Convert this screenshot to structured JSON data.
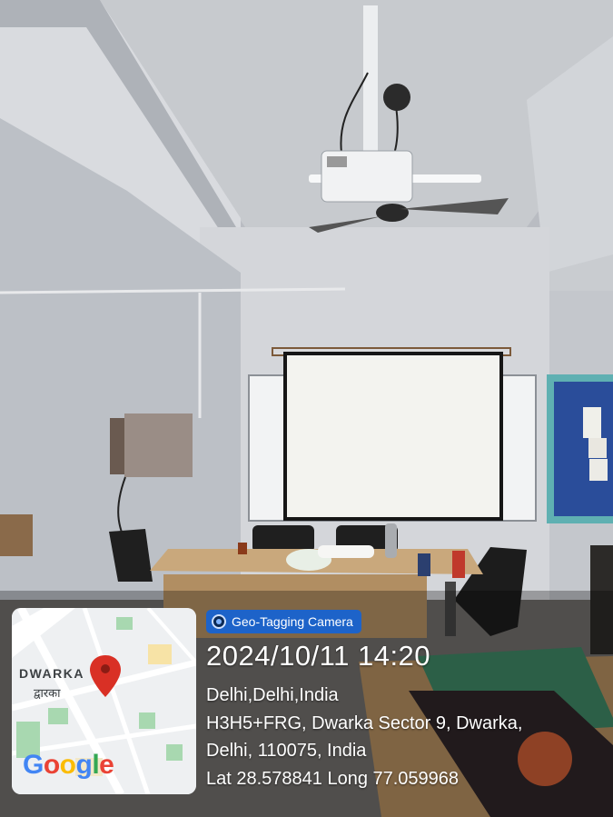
{
  "badge": {
    "label": "Geo-Tagging Camera",
    "icon": "camera-icon"
  },
  "datetime": "2024/10/11 14:20",
  "address": {
    "line1": "Delhi,Delhi,India",
    "line2": "H3H5+FRG, Dwarka Sector 9, Dwarka,",
    "line3": "Delhi, 110075, India"
  },
  "coordinates": "Lat 28.578841 Long 77.059968",
  "map": {
    "label_en": "DWARKA",
    "label_hi": "द्वारका",
    "brand_letters": [
      "G",
      "o",
      "o",
      "g",
      "l",
      "e"
    ],
    "brand_colors": [
      "#4285F4",
      "#EA4335",
      "#FBBC05",
      "#4285F4",
      "#34A853",
      "#EA4335"
    ],
    "pin_color": "#d93025",
    "pin_icon": "map-pin-icon"
  }
}
